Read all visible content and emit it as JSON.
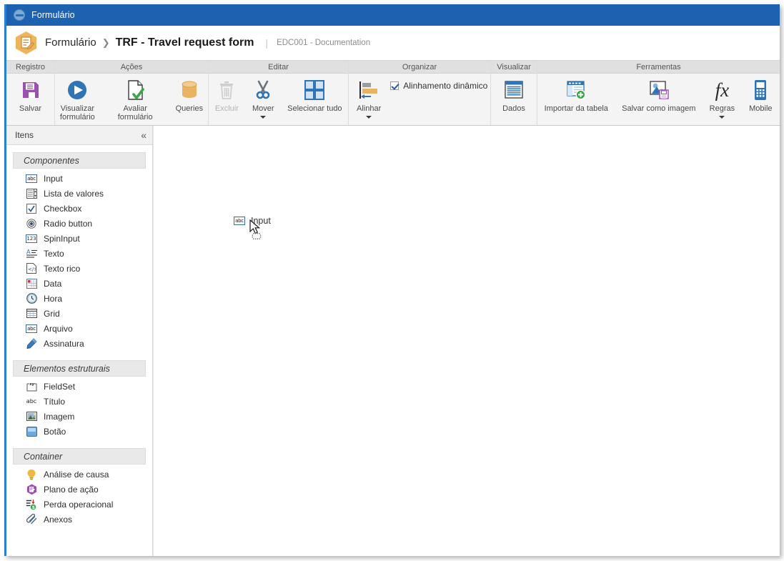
{
  "window": {
    "titlebar": {
      "title": "Formulário",
      "icon": "globe-icon"
    }
  },
  "breadcrumb": {
    "icon": "form-hexagon-icon",
    "root": "Formulário",
    "separator": "❯",
    "current": "TRF - Travel request form",
    "divider": "|",
    "subtitle": "EDC001 - Documentation"
  },
  "ribbon": {
    "groups": [
      {
        "title": "Registro",
        "items": [
          {
            "label": "Salvar",
            "icon": "save-floppy-icon",
            "disabled": false,
            "caret": false
          }
        ]
      },
      {
        "title": "Ações",
        "items": [
          {
            "label": "Visualizar\nformulário",
            "icon": "play-circle-icon",
            "disabled": false,
            "caret": false
          },
          {
            "label": "Avaliar formulário",
            "icon": "document-check-icon",
            "disabled": false,
            "caret": false
          },
          {
            "label": "Queries",
            "icon": "database-cylinder-icon",
            "disabled": false,
            "caret": false
          }
        ]
      },
      {
        "title": "Editar",
        "items": [
          {
            "label": "Excluir",
            "icon": "trash-icon",
            "disabled": true,
            "caret": false
          },
          {
            "label": "Mover",
            "icon": "scissors-icon",
            "disabled": false,
            "caret": true
          },
          {
            "label": "Selecionar tudo",
            "icon": "select-all-grid-icon",
            "disabled": false,
            "caret": false
          }
        ]
      },
      {
        "title": "Organizar",
        "items": [
          {
            "label": "Alinhar",
            "icon": "align-left-icon",
            "disabled": false,
            "caret": true
          }
        ],
        "checkbox": {
          "label": "Alinhamento dinâmico",
          "checked": true
        }
      },
      {
        "title": "Visualizar",
        "items": [
          {
            "label": "Dados",
            "icon": "data-lines-icon",
            "disabled": false,
            "caret": false
          }
        ]
      },
      {
        "title": "Ferramentas",
        "items": [
          {
            "label": "Importar da tabela",
            "icon": "table-import-icon",
            "disabled": false,
            "caret": false
          },
          {
            "label": "Salvar como imagem",
            "icon": "image-save-icon",
            "disabled": false,
            "caret": false
          },
          {
            "label": "Regras",
            "icon": "fx-formula-icon",
            "disabled": false,
            "caret": true
          },
          {
            "label": "Mobile",
            "icon": "mobile-phone-icon",
            "disabled": false,
            "caret": false
          }
        ]
      }
    ]
  },
  "sidebar": {
    "header": {
      "title": "Itens",
      "collapse_icon": "«"
    },
    "sections": [
      {
        "title": "Componentes",
        "items": [
          {
            "label": "Input",
            "icon": "abc-input-icon"
          },
          {
            "label": "Lista de valores",
            "icon": "list-values-icon"
          },
          {
            "label": "Checkbox",
            "icon": "checkbox-icon"
          },
          {
            "label": "Radio button",
            "icon": "radio-button-icon"
          },
          {
            "label": "SpinInput",
            "icon": "spin-input-123-icon"
          },
          {
            "label": "Texto",
            "icon": "text-paragraph-icon"
          },
          {
            "label": "Texto rico",
            "icon": "rich-text-icon"
          },
          {
            "label": "Data",
            "icon": "calendar-date-icon"
          },
          {
            "label": "Hora",
            "icon": "clock-time-icon"
          },
          {
            "label": "Grid",
            "icon": "grid-table-icon"
          },
          {
            "label": "Arquivo",
            "icon": "abc-file-icon"
          },
          {
            "label": "Assinatura",
            "icon": "pencil-signature-icon"
          }
        ]
      },
      {
        "title": "Elementos estruturais",
        "items": [
          {
            "label": "FieldSet",
            "icon": "fieldset-xy-icon"
          },
          {
            "label": "Título",
            "icon": "abc-title-icon"
          },
          {
            "label": "Imagem",
            "icon": "picture-image-icon"
          },
          {
            "label": "Botão",
            "icon": "button-icon"
          }
        ]
      },
      {
        "title": "Container",
        "items": [
          {
            "label": "Análise de causa",
            "icon": "lightbulb-icon"
          },
          {
            "label": "Plano de ação",
            "icon": "action-plan-hexagon-icon"
          },
          {
            "label": "Perda operacional",
            "icon": "operational-loss-icon"
          },
          {
            "label": "Anexos",
            "icon": "paperclip-icon"
          }
        ]
      }
    ]
  },
  "canvas": {
    "field": {
      "label": "Input",
      "icon": "abc-input-icon"
    },
    "cursor": {
      "icon": "drag-arrow-cursor"
    }
  },
  "colors": {
    "titlebar": "#1c62b1",
    "accent_border": "#2a7fd4",
    "hex_orange": "#eeb45c",
    "ribbon_bg": "#f4f4f4",
    "group_header_bg": "#e0e0e0",
    "icon_blue": "#2f74b5",
    "icon_purple": "#8e4aa0",
    "icon_green": "#3aa648",
    "icon_tan": "#e8b464"
  }
}
